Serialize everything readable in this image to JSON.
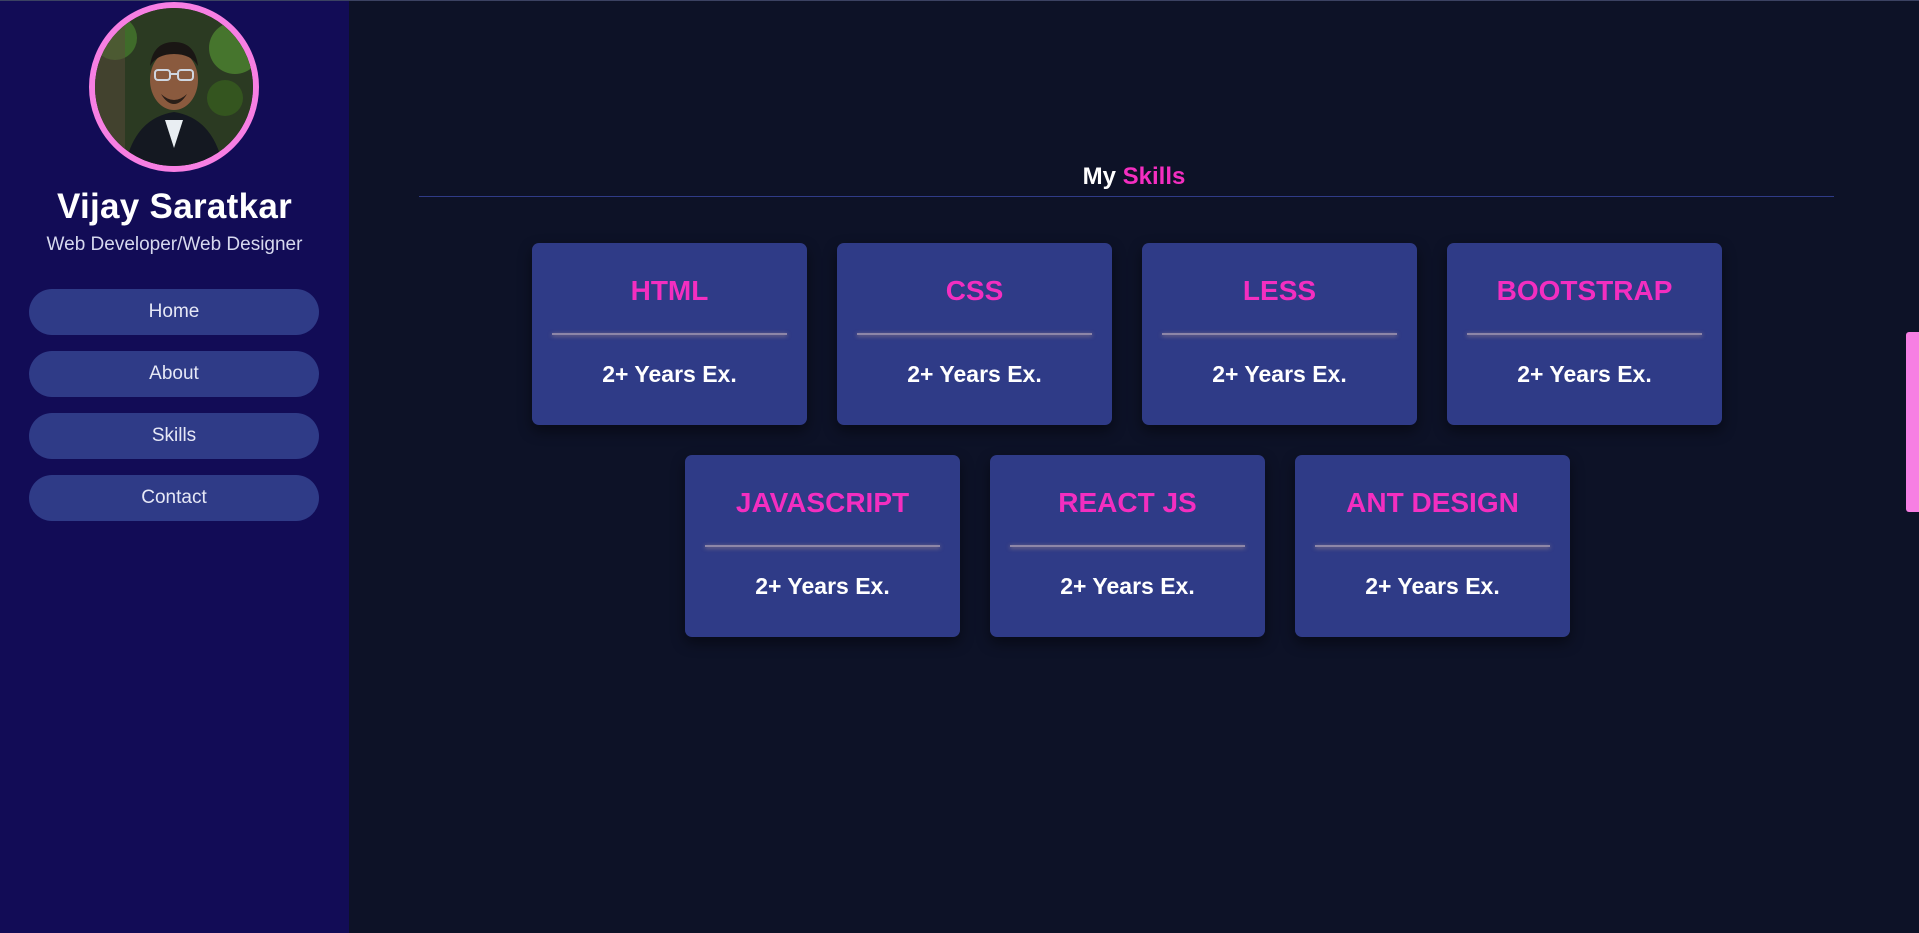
{
  "profile": {
    "name": "Vijay Saratkar",
    "role": "Web Developer/Web Designer"
  },
  "nav": {
    "items": [
      {
        "label": "Home"
      },
      {
        "label": "About"
      },
      {
        "label": "Skills"
      },
      {
        "label": "Contact"
      }
    ]
  },
  "skills_section": {
    "title_prefix": "My",
    "title_accent": "Skills",
    "cards": [
      {
        "skill": "HTML",
        "experience": "2+ Years Ex."
      },
      {
        "skill": "CSS",
        "experience": "2+ Years Ex."
      },
      {
        "skill": "LESS",
        "experience": "2+ Years Ex."
      },
      {
        "skill": "BOOTSTRAP",
        "experience": "2+ Years Ex."
      },
      {
        "skill": "JAVASCRIPT",
        "experience": "2+ Years Ex."
      },
      {
        "skill": "REACT JS",
        "experience": "2+ Years Ex."
      },
      {
        "skill": "ANT DESIGN",
        "experience": "2+ Years Ex."
      }
    ]
  },
  "colors": {
    "background": "#0d1227",
    "sidebar": "#120c56",
    "card": "#2f3b87",
    "accent_pink": "#f32ec0",
    "avatar_ring": "#f77fe3"
  }
}
